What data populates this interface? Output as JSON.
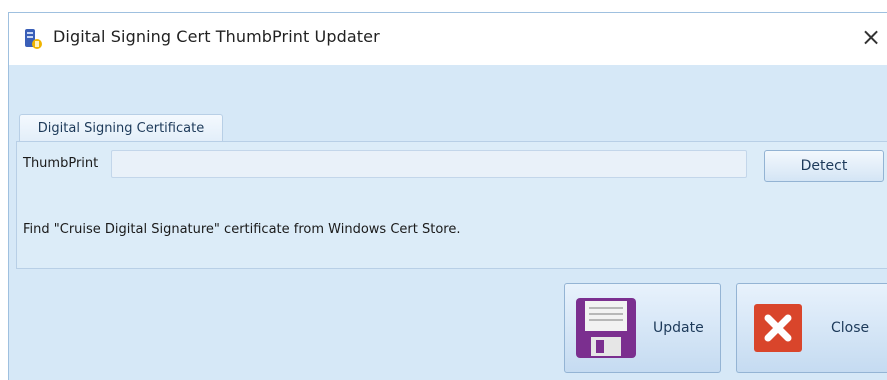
{
  "window": {
    "title": "Digital Signing Cert ThumbPrint Updater",
    "close_glyph": "×"
  },
  "tab": {
    "label": "Digital Signing Certificate"
  },
  "thumbprint": {
    "label": "ThumbPrint",
    "value": "",
    "placeholder": ""
  },
  "detect_button": {
    "label": "Detect"
  },
  "note": {
    "text": "Find \"Cruise Digital Signature\" certificate from Windows Cert Store."
  },
  "update_button": {
    "label": "Update",
    "icon": "floppy-disk-icon",
    "icon_color": "#7b2f8f"
  },
  "close_button": {
    "label": "Close",
    "icon": "close-x-icon",
    "icon_color": "#d9452b"
  }
}
